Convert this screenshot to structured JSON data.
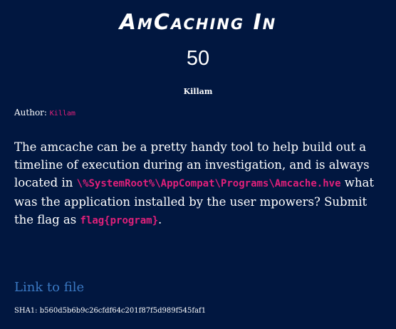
{
  "challenge": {
    "title": "AmCaching In",
    "points": "50",
    "tag": "Killam",
    "author_label": "Author:",
    "author": "Killam",
    "desc_1": "The amcache can be a pretty handy tool to help build out a timeline of execution during an investigation, and is always located in ",
    "path": "\\%SystemRoot%\\AppCompat\\Programs\\Amcache.hve",
    "desc_2": " what was the application installed by the user mpowers? Submit the flag as ",
    "flag_format": "flag{program}",
    "desc_3": ".",
    "link_label": "Link to file",
    "sha1": "SHA1: b560d5b6b9c26cfdf64c201f87f5d989f545faf1"
  },
  "colors": {
    "background": "#011740",
    "accent": "#e0207a",
    "link": "#3a78c2"
  }
}
